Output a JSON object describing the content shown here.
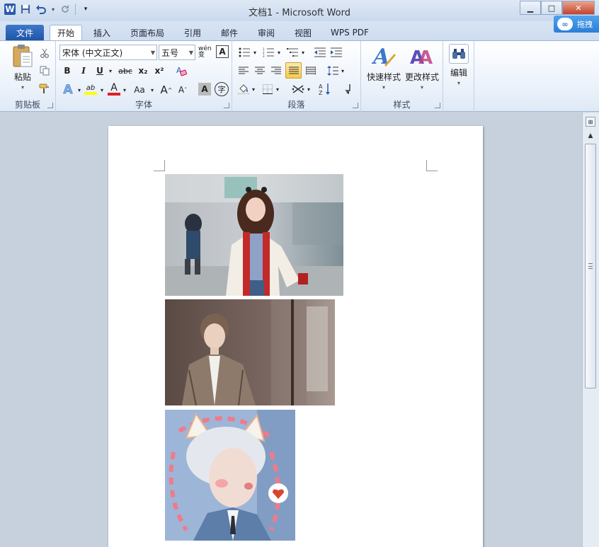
{
  "window": {
    "title": "文档1 - Microsoft Word",
    "min_label": "▁",
    "max_label": "□",
    "close_label": "✕"
  },
  "qat": {
    "app_icon": "W",
    "save_icon": "💾",
    "undo_icon": "↶",
    "redo_icon": "↺",
    "customize_icon": "▾"
  },
  "tabs": {
    "file": "文件",
    "home": "开始",
    "insert": "插入",
    "layout": "页面布局",
    "references": "引用",
    "mailings": "邮件",
    "review": "审阅",
    "view": "视图",
    "wps_pdf": "WPS PDF"
  },
  "cloud": {
    "label": "拖拽"
  },
  "clipboard": {
    "paste_label": "粘贴",
    "group_label": "剪贴板"
  },
  "font": {
    "font_name": "宋体 (中文正文)",
    "font_size": "五号",
    "phonetic": "wén 变",
    "border_char": "A",
    "bold": "B",
    "italic": "I",
    "underline": "U",
    "strike": "abc",
    "subscript": "x₂",
    "superscript": "x²",
    "clear": "A",
    "text_effect": "A",
    "highlight": "ab",
    "font_color": "A",
    "change_case": "Aa",
    "grow": "A",
    "shrink": "A",
    "shading": "A",
    "enclose": "字",
    "group_label": "字体"
  },
  "paragraph": {
    "group_label": "段落"
  },
  "styles": {
    "quick_styles": "快速样式",
    "change_styles": "更改样式",
    "group_label": "样式"
  },
  "editing": {
    "label": "编辑"
  },
  "colors": {
    "accent": "#2b5aad",
    "highlight_yellow": "#ffff00",
    "font_red": "#e02020",
    "close_red": "#c2432a"
  }
}
